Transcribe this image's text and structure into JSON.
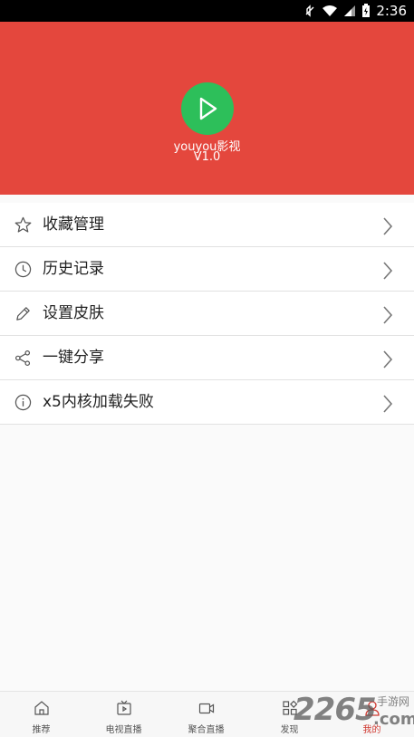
{
  "status_bar": {
    "time": "2:36"
  },
  "app": {
    "name": "youyou影视",
    "version": "V1.0",
    "accent_color": "#e4473d",
    "play_color": "#2dbf5a"
  },
  "menu": [
    {
      "label": "收藏管理",
      "icon": "star-icon"
    },
    {
      "label": "历史记录",
      "icon": "clock-icon"
    },
    {
      "label": "设置皮肤",
      "icon": "pencil-icon"
    },
    {
      "label": "一键分享",
      "icon": "share-icon"
    },
    {
      "label": "x5内核加载失败",
      "icon": "info-icon"
    }
  ],
  "bottom_nav": [
    {
      "label": "推荐",
      "icon": "home-icon",
      "active": false
    },
    {
      "label": "电视直播",
      "icon": "tv-icon",
      "active": false
    },
    {
      "label": "聚合直播",
      "icon": "video-camera-icon",
      "active": false
    },
    {
      "label": "发现",
      "icon": "apps-grid-icon",
      "active": false
    },
    {
      "label": "我的",
      "icon": "user-icon",
      "active": true
    }
  ],
  "watermark": {
    "number": "2265",
    "suffix": ".com",
    "site_name": "手游网"
  }
}
